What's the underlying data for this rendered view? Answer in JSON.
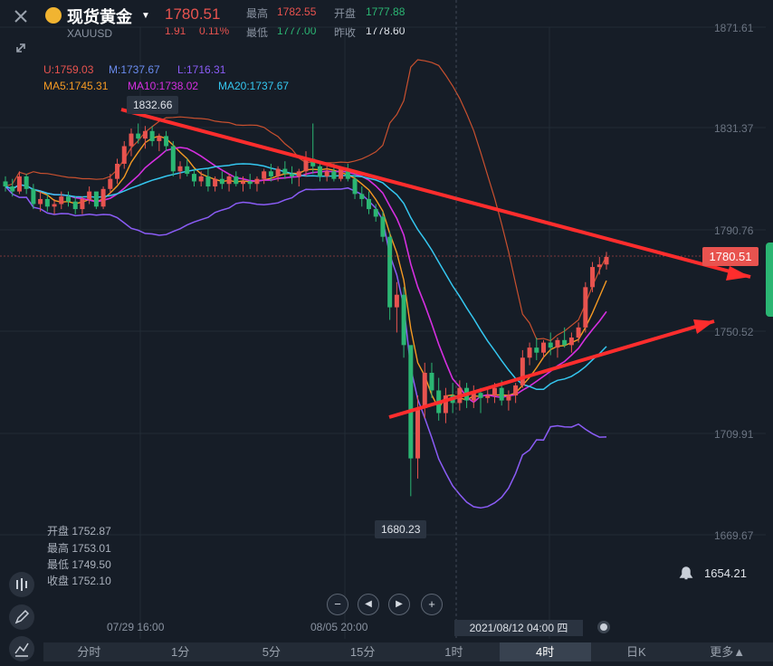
{
  "header": {
    "title": "现货黄金",
    "symbol": "XAUUSD",
    "price": "1780.51",
    "change": "1.91",
    "change_pct": "0.11%",
    "high_label": "最高",
    "high_value": "1782.55",
    "open_label": "开盘",
    "open_value": "1777.88",
    "low_label": "最低",
    "low_value": "1777.00",
    "prev_close_label": "昨收",
    "prev_close_value": "1778.60"
  },
  "indicators": {
    "boll": [
      "U:1759.03",
      "M:1737.67",
      "L:1716.31"
    ],
    "ma": [
      "MA5:1745.31",
      "MA10:1738.02",
      "MA20:1737.67"
    ]
  },
  "y_axis": [
    "1871.61",
    "1831.37",
    "1790.76",
    "1750.52",
    "1709.91",
    "1669.67"
  ],
  "x_axis": [
    "07/29 16:00",
    "08/05 20:00"
  ],
  "callouts": {
    "high": "1832.66",
    "low": "1680.23"
  },
  "current_price_tag": "1780.51",
  "alert_value": "1654.21",
  "crosshair_date": "2021/08/12 04:00 四",
  "ohlc_box": [
    {
      "label": "开盘",
      "value": "1752.87"
    },
    {
      "label": "最高",
      "value": "1753.01"
    },
    {
      "label": "最低",
      "value": "1749.50"
    },
    {
      "label": "收盘",
      "value": "1752.10"
    }
  ],
  "periods": [
    "分时",
    "1分",
    "5分",
    "15分",
    "1时",
    "4时",
    "日K",
    "更多▲"
  ],
  "active_period": "4时",
  "zoom_controls": [
    "−",
    "◀",
    "▶",
    "+"
  ],
  "colors": {
    "up": "#e8534f",
    "down": "#2bb673",
    "ma5": "#f59a23",
    "ma10": "#d52fe0",
    "ma20": "#35c7f0",
    "boll_u": "#c8502f",
    "boll_l": "#8b5cf6",
    "boll_m": "#6b8cf0",
    "trendline": "#ff2d2d"
  },
  "chart_data": {
    "type": "candlestick",
    "y_ticks": [
      1871.61,
      1831.37,
      1790.76,
      1750.52,
      1709.91,
      1669.67
    ],
    "x_ticks": [
      "07/29 16:00",
      "08/05 20:00"
    ],
    "candles": [
      [
        1810,
        1812,
        1806,
        1808
      ],
      [
        1808,
        1811,
        1804,
        1806
      ],
      [
        1806,
        1814,
        1805,
        1812
      ],
      [
        1812,
        1813,
        1805,
        1807
      ],
      [
        1807,
        1809,
        1799,
        1801
      ],
      [
        1801,
        1806,
        1798,
        1803
      ],
      [
        1803,
        1805,
        1798,
        1800
      ],
      [
        1800,
        1803,
        1797,
        1801
      ],
      [
        1801,
        1806,
        1799,
        1804
      ],
      [
        1804,
        1806,
        1800,
        1802
      ],
      [
        1802,
        1804,
        1797,
        1799
      ],
      [
        1799,
        1804,
        1797,
        1803
      ],
      [
        1803,
        1808,
        1801,
        1806
      ],
      [
        1806,
        1804,
        1799,
        1800
      ],
      [
        1800,
        1808,
        1799,
        1807
      ],
      [
        1807,
        1813,
        1805,
        1811
      ],
      [
        1811,
        1819,
        1809,
        1817
      ],
      [
        1817,
        1826,
        1815,
        1824
      ],
      [
        1824,
        1831,
        1820,
        1829
      ],
      [
        1829,
        1833,
        1825,
        1827
      ],
      [
        1827,
        1832,
        1823,
        1830
      ],
      [
        1830,
        1832,
        1824,
        1826
      ],
      [
        1826,
        1829,
        1822,
        1828
      ],
      [
        1828,
        1830,
        1822,
        1824
      ],
      [
        1824,
        1826,
        1812,
        1814
      ],
      [
        1814,
        1818,
        1811,
        1816
      ],
      [
        1816,
        1819,
        1812,
        1813
      ],
      [
        1813,
        1815,
        1808,
        1810
      ],
      [
        1810,
        1814,
        1808,
        1812
      ],
      [
        1812,
        1815,
        1806,
        1808
      ],
      [
        1808,
        1812,
        1806,
        1811
      ],
      [
        1811,
        1814,
        1807,
        1809
      ],
      [
        1809,
        1813,
        1806,
        1812
      ],
      [
        1812,
        1814,
        1808,
        1809
      ],
      [
        1809,
        1812,
        1806,
        1810
      ],
      [
        1810,
        1813,
        1807,
        1809
      ],
      [
        1809,
        1812,
        1806,
        1811
      ],
      [
        1811,
        1815,
        1809,
        1814
      ],
      [
        1814,
        1817,
        1810,
        1812
      ],
      [
        1812,
        1816,
        1810,
        1815
      ],
      [
        1815,
        1818,
        1811,
        1813
      ],
      [
        1813,
        1816,
        1809,
        1812
      ],
      [
        1812,
        1815,
        1808,
        1814
      ],
      [
        1814,
        1822,
        1812,
        1819
      ],
      [
        1819,
        1833,
        1813,
        1816
      ],
      [
        1816,
        1818,
        1810,
        1812
      ],
      [
        1812,
        1816,
        1810,
        1814
      ],
      [
        1814,
        1817,
        1810,
        1811
      ],
      [
        1811,
        1816,
        1810,
        1815
      ],
      [
        1815,
        1817,
        1810,
        1811
      ],
      [
        1811,
        1813,
        1803,
        1805
      ],
      [
        1805,
        1808,
        1800,
        1803
      ],
      [
        1803,
        1806,
        1797,
        1799
      ],
      [
        1799,
        1801,
        1794,
        1796
      ],
      [
        1796,
        1798,
        1786,
        1788
      ],
      [
        1788,
        1790,
        1755,
        1760
      ],
      [
        1760,
        1770,
        1750,
        1765
      ],
      [
        1765,
        1768,
        1740,
        1745
      ],
      [
        1745,
        1742,
        1685,
        1700
      ],
      [
        1700,
        1725,
        1692,
        1720
      ],
      [
        1720,
        1738,
        1716,
        1734
      ],
      [
        1734,
        1738,
        1724,
        1727
      ],
      [
        1727,
        1732,
        1715,
        1718
      ],
      [
        1718,
        1728,
        1714,
        1725
      ],
      [
        1725,
        1730,
        1718,
        1722
      ],
      [
        1722,
        1731,
        1719,
        1728
      ],
      [
        1728,
        1730,
        1720,
        1723
      ],
      [
        1723,
        1729,
        1720,
        1726
      ],
      [
        1726,
        1728,
        1718,
        1724
      ],
      [
        1724,
        1728,
        1722,
        1725
      ],
      [
        1725,
        1730,
        1722,
        1728
      ],
      [
        1728,
        1731,
        1721,
        1723
      ],
      [
        1723,
        1727,
        1719,
        1725
      ],
      [
        1725,
        1730,
        1722,
        1729
      ],
      [
        1729,
        1743,
        1728,
        1740
      ],
      [
        1740,
        1746,
        1737,
        1744
      ],
      [
        1744,
        1748,
        1739,
        1742
      ],
      [
        1742,
        1747,
        1740,
        1746
      ],
      [
        1746,
        1750,
        1741,
        1744
      ],
      [
        1744,
        1748,
        1740,
        1747
      ],
      [
        1747,
        1752,
        1744,
        1745
      ],
      [
        1745,
        1750,
        1742,
        1748
      ],
      [
        1748,
        1754,
        1746,
        1752
      ],
      [
        1752,
        1770,
        1750,
        1768
      ],
      [
        1768,
        1778,
        1766,
        1776
      ],
      [
        1776,
        1780,
        1773,
        1777
      ],
      [
        1777,
        1782,
        1775,
        1780
      ]
    ]
  }
}
